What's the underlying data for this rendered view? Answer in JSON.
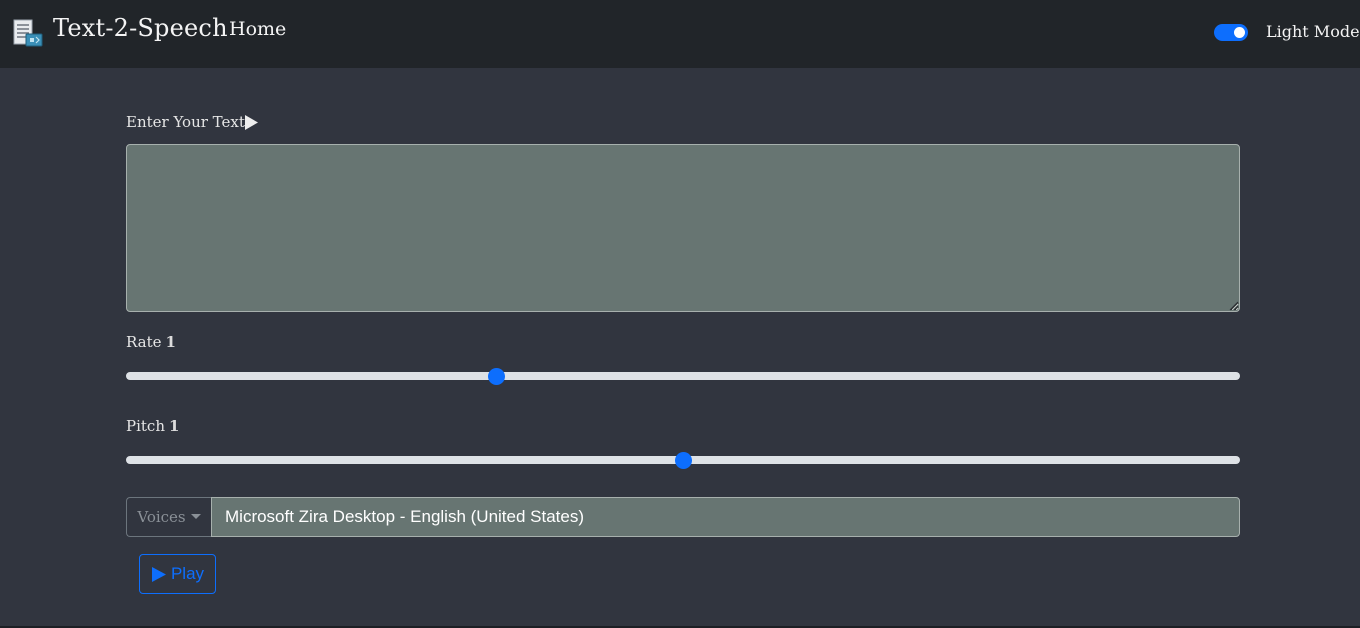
{
  "navbar": {
    "brand": "Text-2-Speech",
    "home_link": "Home",
    "mode_toggle_label": "Light Mode",
    "mode_toggle_on": true
  },
  "main": {
    "text_label": "Enter Your Text",
    "text_value": "",
    "rate": {
      "label": "Rate",
      "value": "1",
      "fraction": 0.33
    },
    "pitch": {
      "label": "Pitch",
      "value": "1",
      "fraction": 0.5
    },
    "voices_button": "Voices",
    "selected_voice": "Microsoft Zira Desktop - English (United States)",
    "play_button": "Play"
  },
  "colors": {
    "navbar_bg": "#212529",
    "page_bg": "#31353f",
    "accent": "#0d6efd",
    "input_bg": "#677572"
  },
  "icons": [
    "document-speech-icon",
    "play-icon",
    "chevron-down-icon",
    "resize-grip-icon"
  ]
}
